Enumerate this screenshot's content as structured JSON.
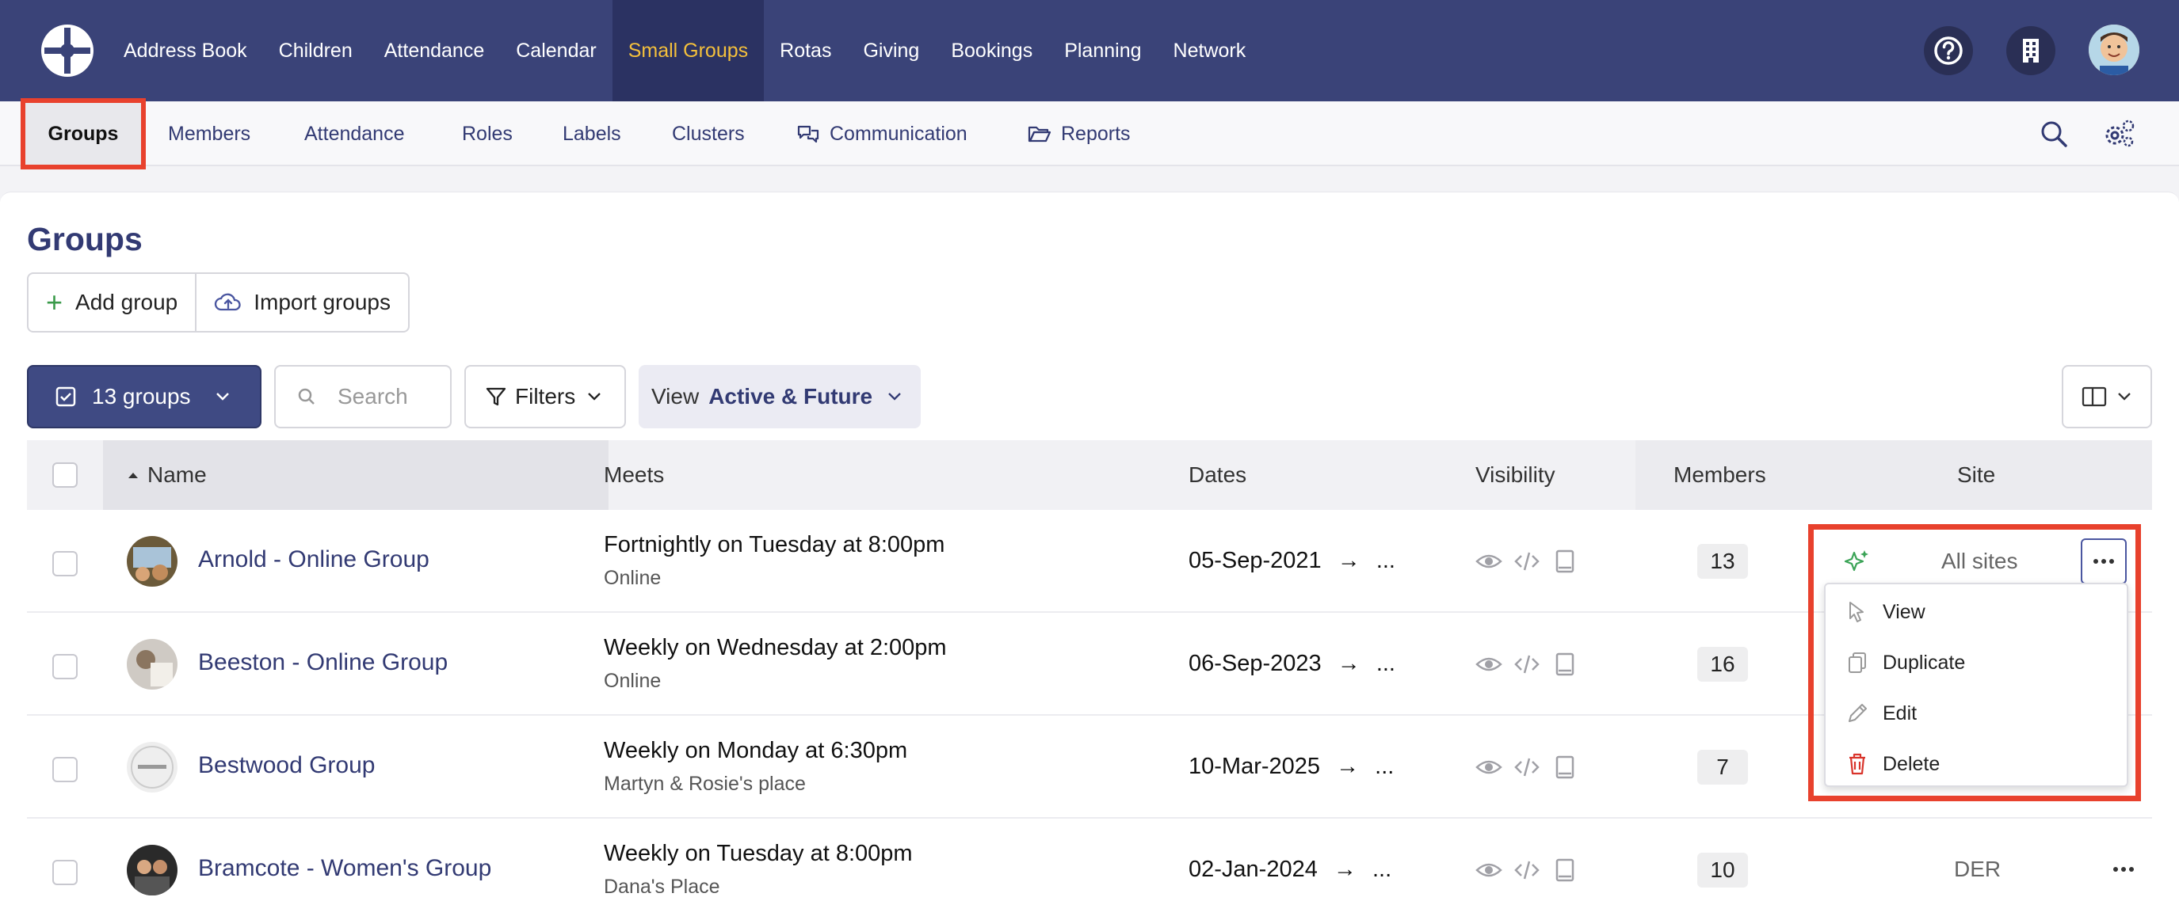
{
  "topnav": {
    "items": [
      "Address Book",
      "Children",
      "Attendance",
      "Calendar",
      "Small Groups",
      "Rotas",
      "Giving",
      "Bookings",
      "Planning",
      "Network"
    ],
    "active": "Small Groups",
    "active_color": "#f4c03c",
    "icons": [
      "help-icon",
      "building-icon",
      "user-avatar"
    ]
  },
  "subnav": {
    "items": [
      "Groups",
      "Members",
      "Attendance",
      "Roles",
      "Labels",
      "Clusters",
      "Communication",
      "Reports"
    ],
    "active": "Groups",
    "icons": [
      "search-icon",
      "settings-gears-icon"
    ]
  },
  "page": {
    "title": "Groups",
    "add_group": "Add group",
    "import_groups": "Import groups",
    "groups_count": "13 groups",
    "search_placeholder": "Search",
    "filters": "Filters",
    "view_label": "View",
    "view_value": "Active & Future"
  },
  "table": {
    "headers": [
      "Name",
      "Meets",
      "Dates",
      "Visibility",
      "Members",
      "Site"
    ],
    "rows": [
      {
        "name": "Arnold - Online Group",
        "meets": "Fortnightly on Tuesday at 8:00pm",
        "location": "Online",
        "date": "05-Sep-2021",
        "date_end": "...",
        "members": "13",
        "site": "All sites"
      },
      {
        "name": "Beeston - Online Group",
        "meets": "Weekly on Wednesday at 2:00pm",
        "location": "Online",
        "date": "06-Sep-2023",
        "date_end": "...",
        "members": "16",
        "site": ""
      },
      {
        "name": "Bestwood Group",
        "meets": "Weekly on Monday at 6:30pm",
        "location": "Martyn & Rosie's place",
        "date": "10-Mar-2025",
        "date_end": "...",
        "members": "7",
        "site": ""
      },
      {
        "name": "Bramcote - Women's Group",
        "meets": "Weekly on Tuesday at 8:00pm",
        "location": "Dana's Place",
        "date": "02-Jan-2024",
        "date_end": "...",
        "members": "10",
        "site": "DER"
      }
    ]
  },
  "row_menu": {
    "items": [
      "View",
      "Duplicate",
      "Edit",
      "Delete"
    ],
    "delete_icon_color": "#d9342b"
  },
  "colors": {
    "nav_bg": "#3a4378",
    "primary": "#323a73",
    "highlight_box": "#e8412d"
  }
}
